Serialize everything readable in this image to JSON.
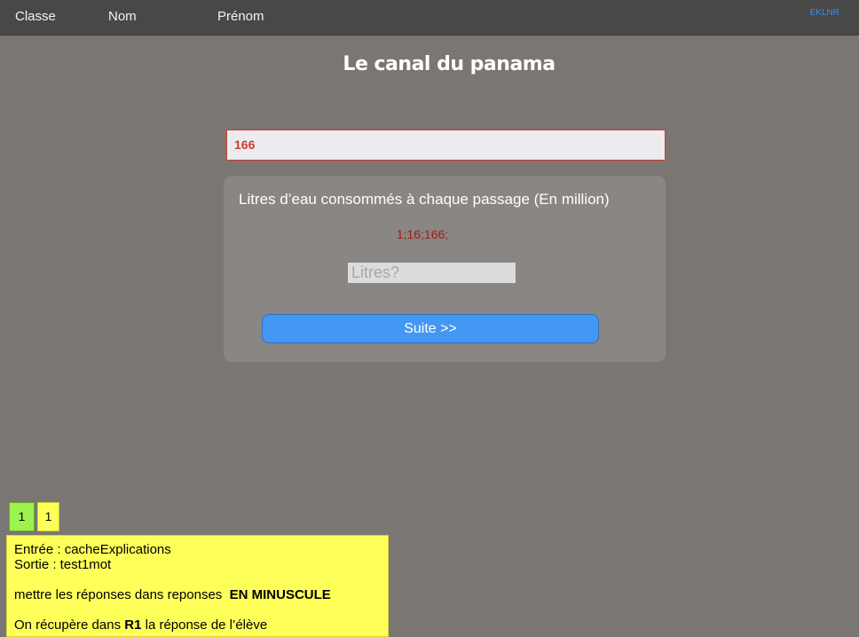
{
  "header": {
    "classe_label": "Classe",
    "nom_label": "Nom",
    "prenom_label": "Prénom",
    "code": "EKLNR"
  },
  "title": "Le canal du panama",
  "answer_display": "166",
  "question": {
    "text": "Litres d’eau consommés à chaque passage (En million)",
    "hint": "1;16;166;",
    "input_placeholder": "Litres?",
    "input_value": "",
    "button_label": "Suite >>"
  },
  "badges": {
    "green": "1",
    "yellow": "1"
  },
  "notes": {
    "line1": "Entrée : cacheExplications",
    "line2": "Sortie : test1mot",
    "line3_pre": "mettre les réponses dans reponses  ",
    "line3_bold": "EN MINUSCULE",
    "line4_pre": "On récupère dans ",
    "line4_bold": "R1",
    "line4_post": " la réponse de l’élève"
  },
  "colors": {
    "background": "#7a7674",
    "topbar": "#484848",
    "answer_text": "#d13a2e",
    "hint_text": "#a11e12",
    "button": "#4497f3",
    "notes_bg": "#ffff5a",
    "badge_green": "#9df34d"
  }
}
